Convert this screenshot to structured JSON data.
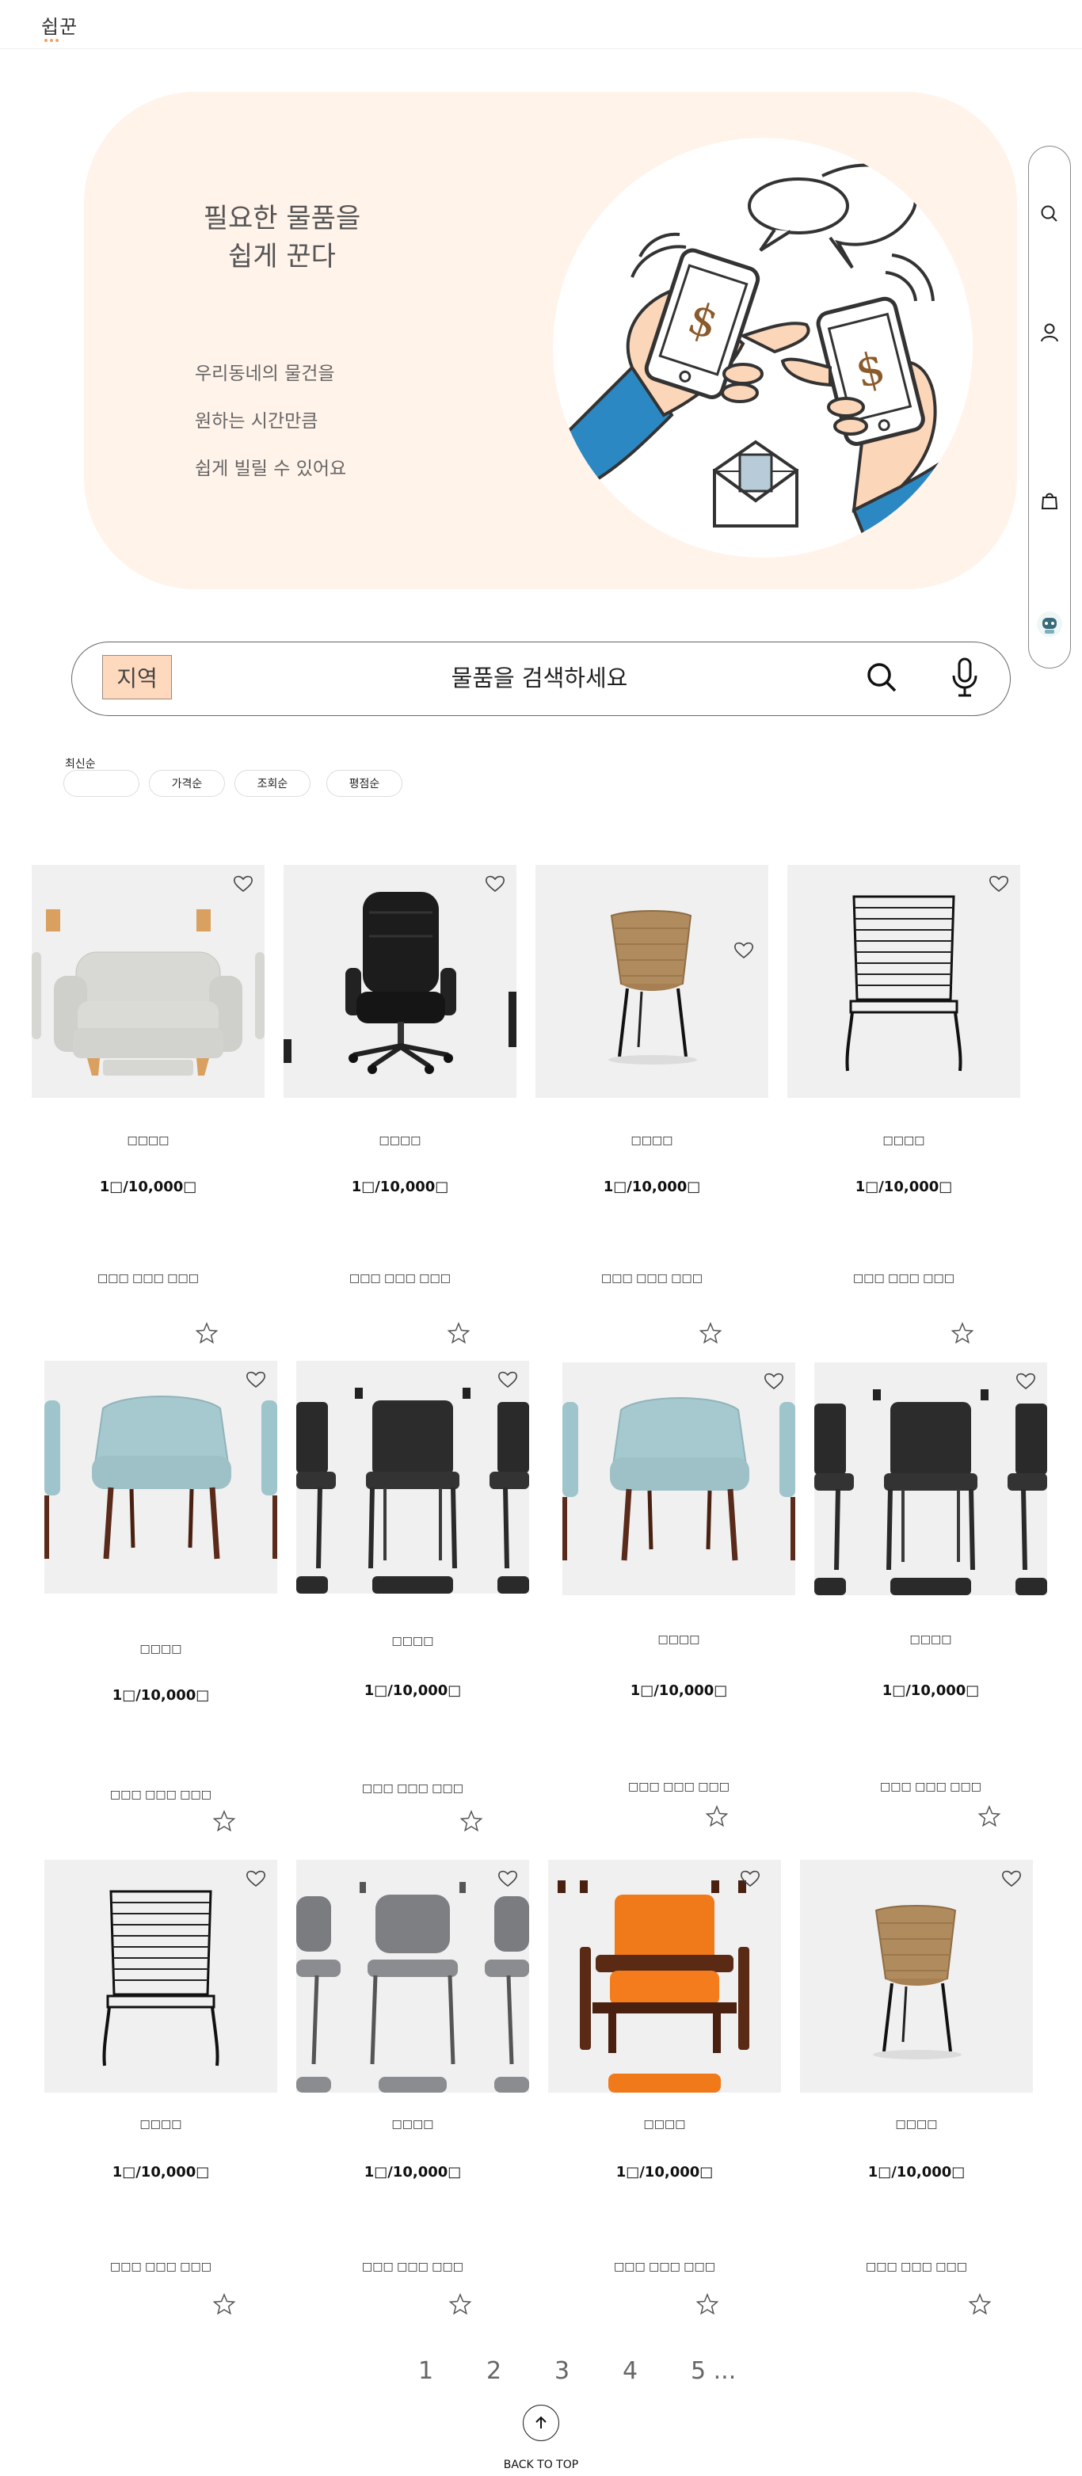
{
  "header": {
    "logo": "쉽꾼"
  },
  "hero": {
    "title_line1": "필요한 물품을",
    "title_line2": "쉽게 꾼다",
    "lines": [
      "우리동네의 물건을",
      "원하는 시간만큼",
      "쉽게 빌릴 수 있어요"
    ]
  },
  "search": {
    "region": "지역",
    "placeholder": "물품을 검색하세요"
  },
  "sort": {
    "label": "최신순",
    "options": [
      "가격순",
      "조회순",
      "평점순"
    ]
  },
  "products": [
    {
      "name": "□□□□",
      "price": "1□/10,000□",
      "sub": "□□□ □□□ □□□",
      "image": "armchair-beige"
    },
    {
      "name": "□□□□",
      "price": "1□/10,000□",
      "sub": "□□□ □□□ □□□",
      "image": "office-chair-black"
    },
    {
      "name": "□□□□",
      "price": "1□/10,000□",
      "sub": "□□□ □□□ □□□",
      "image": "rattan-chair"
    },
    {
      "name": "□□□□",
      "price": "1□/10,000□",
      "sub": "□□□ □□□ □□□",
      "image": "wire-chair"
    },
    {
      "name": "□□□□",
      "price": "1□/10,000□",
      "sub": "□□□ □□□ □□□",
      "image": "teal-armchair"
    },
    {
      "name": "□□□□",
      "price": "1□/10,000□",
      "sub": "□□□ □□□ □□□",
      "image": "black-dining-chairs"
    },
    {
      "name": "□□□□",
      "price": "1□/10,000□",
      "sub": "□□□ □□□ □□□",
      "image": "teal-armchair"
    },
    {
      "name": "□□□□",
      "price": "1□/10,000□",
      "sub": "□□□ □□□ □□□",
      "image": "black-dining-chairs"
    },
    {
      "name": "□□□□",
      "price": "1□/10,000□",
      "sub": "□□□ □□□ □□□",
      "image": "wire-chair"
    },
    {
      "name": "□□□□",
      "price": "1□/10,000□",
      "sub": "□□□ □□□ □□□",
      "image": "grey-dining-chairs"
    },
    {
      "name": "□□□□",
      "price": "1□/10,000□",
      "sub": "□□□ □□□ □□□",
      "image": "orange-lounge-chair"
    },
    {
      "name": "□□□□",
      "price": "1□/10,000□",
      "sub": "□□□ □□□ □□□",
      "image": "rattan-chair"
    }
  ],
  "pagination": {
    "pages": [
      "1",
      "2",
      "3",
      "4",
      "5 ..."
    ]
  },
  "back_to_top": "BACK TO TOP",
  "icons": {
    "heart": "heart-icon",
    "star": "star-icon",
    "search": "search-icon",
    "mic": "microphone-icon",
    "user": "user-icon",
    "bag": "shopping-bag-icon",
    "chatbot": "chatbot-icon",
    "arrow_up": "arrow-up-icon"
  },
  "colors": {
    "hero_bg": "#fff3ea",
    "region_bg": "#ffd9bd",
    "card_bg": "#f0f0f0"
  }
}
